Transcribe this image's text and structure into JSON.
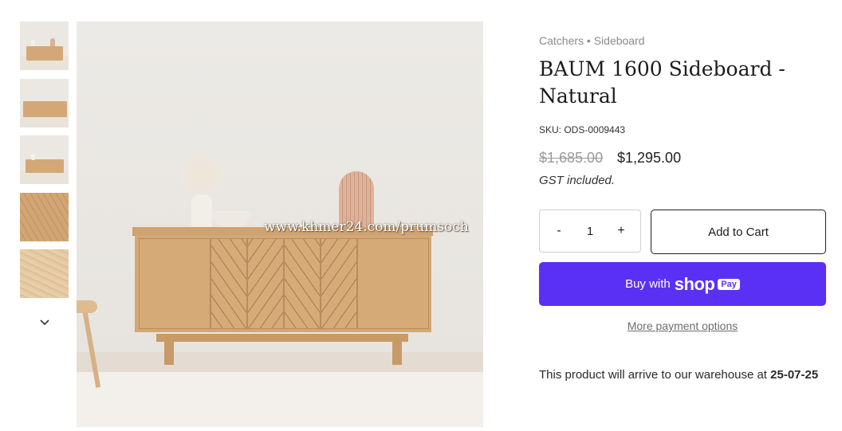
{
  "thumbnails": [
    {
      "alt": "sideboard-front-view"
    },
    {
      "alt": "sideboard-angle-view"
    },
    {
      "alt": "sideboard-room-view"
    },
    {
      "alt": "herringbone-door-detail"
    },
    {
      "alt": "wood-grain-detail"
    }
  ],
  "gallery": {
    "watermark": "www.khmer24.com/prumsoch"
  },
  "breadcrumb": {
    "items": [
      "Catchers",
      "Sideboard"
    ],
    "separator": "•"
  },
  "product": {
    "title": "BAUM 1600 Sideboard - Natural",
    "sku": "SKU: ODS-0009443",
    "price_original": "$1,685.00",
    "price_sale": "$1,295.00",
    "tax_note": "GST included."
  },
  "quantity": {
    "minus": "-",
    "value": "1",
    "plus": "+"
  },
  "buttons": {
    "add_to_cart": "Add to Cart",
    "buy_with": "Buy with",
    "shop": "shop",
    "pay": "Pay",
    "more_payment": "More payment options"
  },
  "arrival": {
    "text": "This product will arrive to our warehouse at",
    "date": "25-07-25"
  },
  "colors": {
    "shop_pay": "#5a31f4",
    "accent_text": "#1c1c1c"
  }
}
